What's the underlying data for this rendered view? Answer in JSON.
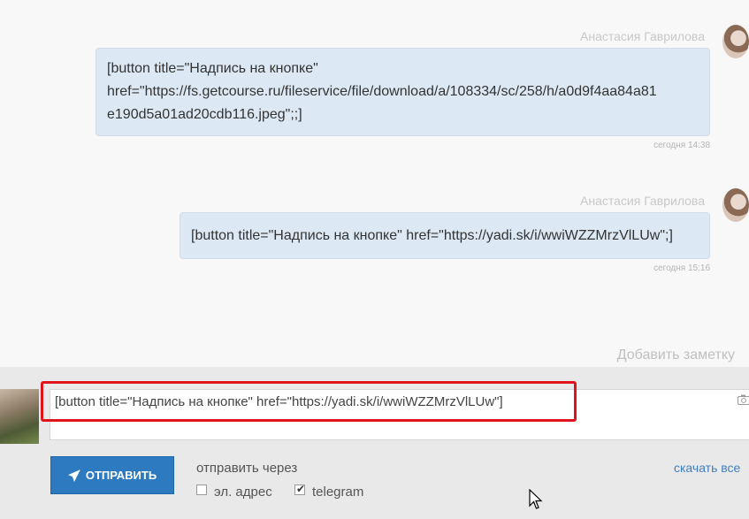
{
  "messages": [
    {
      "sender": "Анастасия Гаврилова",
      "text_lines": [
        "[button title=\"Надпись на кнопке\"",
        "href=\"https://fs.getcourse.ru/fileservice/file/download/a/108334/sc/258/h/a0d9f4aa84a81",
        "e190d5a01ad20cdb116.jpeg\";;]"
      ],
      "time": "сегодня 14:38"
    },
    {
      "sender": "Анастасия Гаврилова",
      "text_lines": [
        "[button title=\"Надпись на кнопке\" href=\"https://yadi.sk/i/wwiWZZMrzVlLUw\";]"
      ],
      "time": "сегодня 15:16"
    }
  ],
  "add_note_label": "Добавить заметку",
  "composer": {
    "input_value": "[button title=\"Надпись на кнопке\" href=\"https://yadi.sk/i/wwiWZZMrzVlLUw\"]",
    "send_label": "ОТПРАВИТЬ",
    "send_via_label": "отправить через",
    "channels": [
      {
        "label": "эл. адрес",
        "checked": false
      },
      {
        "label": "telegram",
        "checked": true
      }
    ],
    "download_link": "скачать все"
  },
  "colors": {
    "bubble": "#dce9f4",
    "send_button": "#2e7ac0",
    "highlight_border": "#e0141c",
    "link": "#3f7fc1"
  }
}
